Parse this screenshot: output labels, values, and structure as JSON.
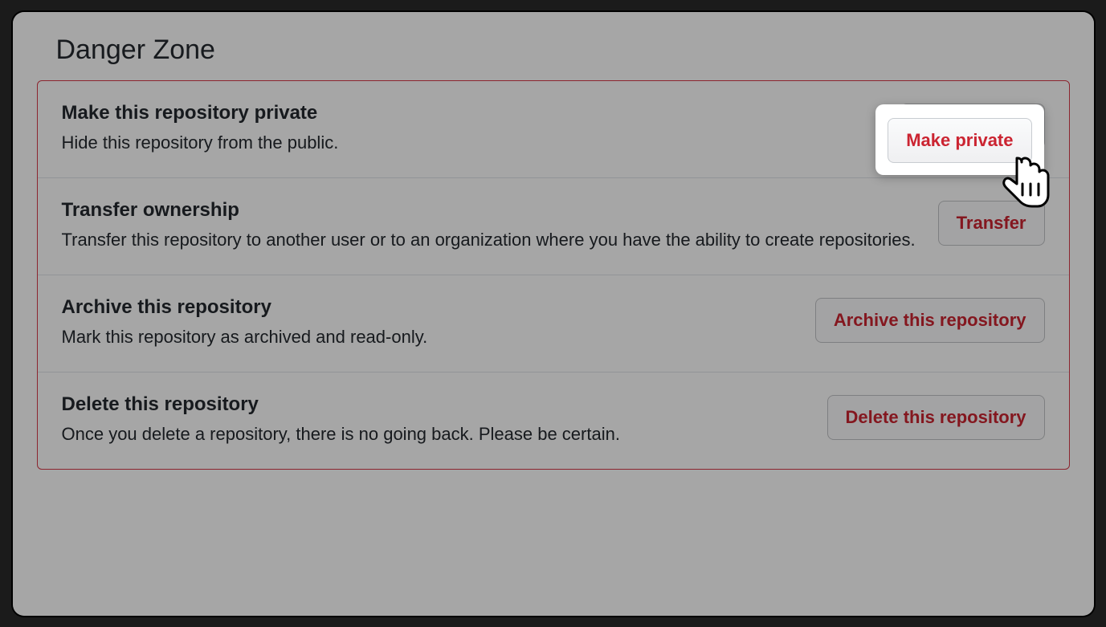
{
  "panel": {
    "title": "Danger Zone"
  },
  "rows": [
    {
      "title": "Make this repository private",
      "description": "Hide this repository from the public.",
      "button_label": "Make private"
    },
    {
      "title": "Transfer ownership",
      "description": "Transfer this repository to another user or to an organization where you have the ability to create repositories.",
      "button_label": "Transfer"
    },
    {
      "title": "Archive this repository",
      "description": "Mark this repository as archived and read-only.",
      "button_label": "Archive this repository"
    },
    {
      "title": "Delete this repository",
      "description": "Once you delete a repository, there is no going back. Please be certain.",
      "button_label": "Delete this repository"
    }
  ]
}
